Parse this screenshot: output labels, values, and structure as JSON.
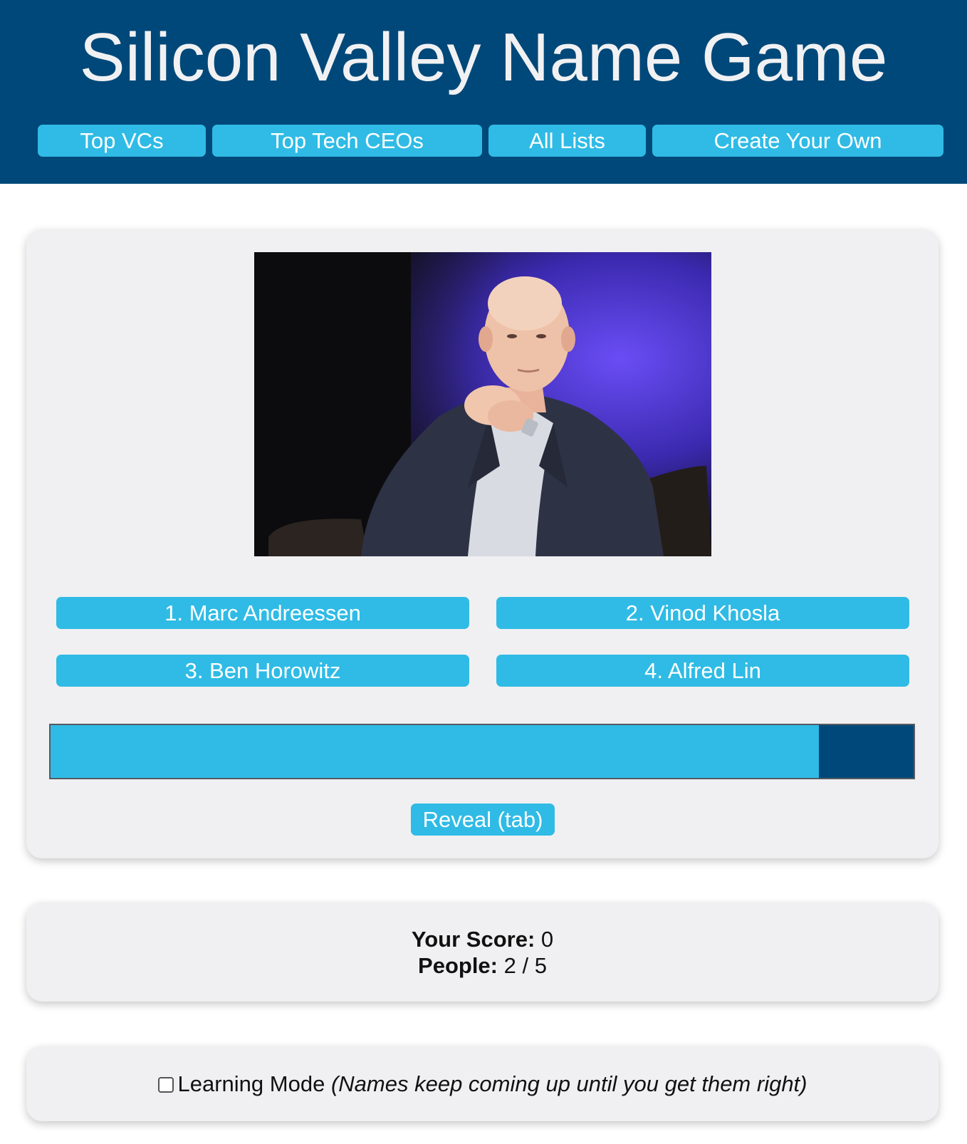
{
  "header": {
    "title": "Silicon Valley Name Game",
    "nav": [
      {
        "label": "Top VCs"
      },
      {
        "label": "Top Tech CEOs"
      },
      {
        "label": "All Lists"
      },
      {
        "label": "Create Your Own"
      }
    ]
  },
  "quiz": {
    "photo_subject": "person seated in chair with clasped hands, purple stage backdrop",
    "answers": [
      {
        "label": "1. Marc Andreessen"
      },
      {
        "label": "2. Vinod Khosla"
      },
      {
        "label": "3. Ben Horowitz"
      },
      {
        "label": "4. Alfred Lin"
      }
    ],
    "timer_remaining_fraction": 0.89,
    "reveal_label": "Reveal (tab)"
  },
  "score": {
    "score_label": "Your Score:",
    "score_value": "0",
    "people_label": "People:",
    "people_value": "2 / 5"
  },
  "learning": {
    "checkbox_checked": false,
    "label": "Learning Mode",
    "note": "(Names keep coming up until you get them right)"
  },
  "colors": {
    "header_bg": "#004879",
    "button_bg": "#2fbbe5",
    "card_bg": "#f0f0f2"
  }
}
